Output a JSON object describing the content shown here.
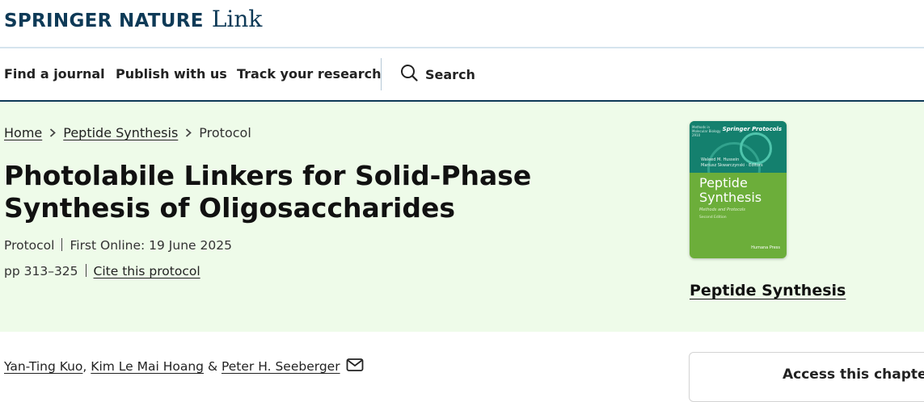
{
  "header": {
    "logo_brand": "SPRINGER NATURE",
    "logo_link": "Link"
  },
  "nav": {
    "find_journal": "Find a journal",
    "publish": "Publish with us",
    "track": "Track your research",
    "search": "Search"
  },
  "breadcrumb": {
    "home": "Home",
    "book": "Peptide Synthesis",
    "current": "Protocol"
  },
  "article": {
    "title": "Photolabile Linkers for Solid-Phase Synthesis of Oligosaccharides",
    "type": "Protocol",
    "first_online": "First Online: 19 June 2025",
    "pages": "pp 313–325",
    "cite": "Cite this protocol"
  },
  "book": {
    "cover_series": "Methods in Molecular Biology 2910",
    "cover_brand": "Springer Protocols",
    "cover_editors": [
      "Waleed M. Hussein",
      "Mariusz Skwarczynski",
      "Editors"
    ],
    "cover_title": "Peptide Synthesis",
    "cover_subtitle": "Methods and Protocols",
    "cover_edition": "Second Edition",
    "cover_publisher": "Humana Press",
    "title": "Peptide Synthesis"
  },
  "authors": {
    "author1": "Yan-Ting Kuo",
    "sep1": ", ",
    "author2": "Kim Le Mai Hoang",
    "sep2": " & ",
    "author3": "Peter H. Seeberger"
  },
  "access": {
    "title": "Access this chapter"
  },
  "colors": {
    "brand": "#0e3a57",
    "hero_bg": "#eefbe9",
    "cover_green": "#6cae3a",
    "cover_teal": "#14806e"
  }
}
